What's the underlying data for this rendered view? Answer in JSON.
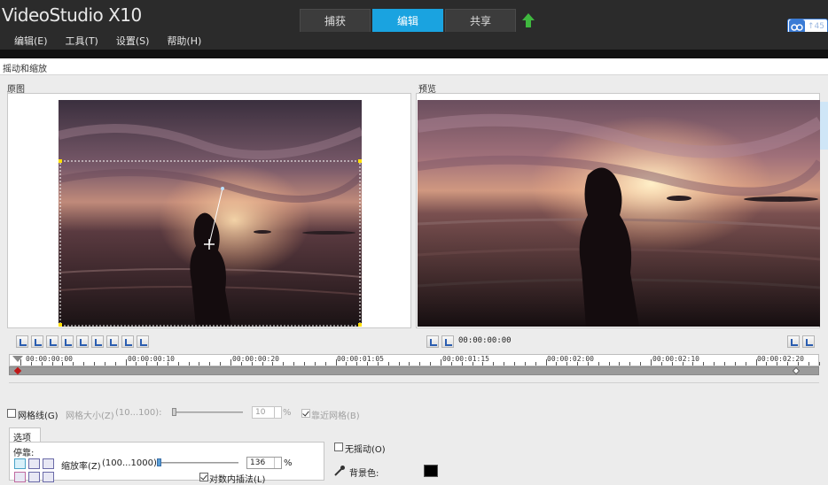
{
  "app": {
    "title": "VideoStudio X10",
    "tabs": [
      {
        "label": "捕获",
        "active": false
      },
      {
        "label": "编辑",
        "active": true
      },
      {
        "label": "共享",
        "active": false
      }
    ],
    "badge_text": "↑45"
  },
  "menu": [
    "编辑(E)",
    "工具(T)",
    "设置(S)",
    "帮助(H)"
  ],
  "dialog": {
    "title": "摇动和缩放",
    "original_label": "原图",
    "preview_label": "预览"
  },
  "preview_controls": {
    "timecode": "00:00:00:00"
  },
  "ruler": {
    "labels": [
      "00:00:00:00",
      "00:00:00:10",
      "00:00:00:20",
      "00:00:01:05",
      "00:00:01:15",
      "00:00:02:00",
      "00:00:02:10",
      "00:00:02:20"
    ]
  },
  "options": {
    "grid_label": "网格线(G)",
    "grid_checked": false,
    "grid_size_label": "网格大小(Z)",
    "grid_size_range": "(10...100):",
    "grid_size_value": "10",
    "grid_size_unit": "%",
    "snap_label": "靠近网格(B)",
    "snap_checked": true,
    "options_tab": "选项",
    "stop_label": "停靠:",
    "zoom_label": "缩放率(Z)",
    "zoom_range": "(100...1000):",
    "zoom_value": "136",
    "zoom_unit": "%",
    "interpolation_label": "对数内插法(L)",
    "interpolation_checked": true,
    "no_shake_label": "无摇动(O)",
    "no_shake_checked": false,
    "bg_color_label": "背景色:",
    "bg_color": "#000000"
  },
  "colors": {
    "accent": "#1aa3e0",
    "titlebar": "#2b2b2b",
    "keyframe_red": "#c01818"
  },
  "icons": {
    "upload": "green-up-arrow",
    "cloud": "cloud-icon",
    "dropper": "eyedropper-icon"
  }
}
